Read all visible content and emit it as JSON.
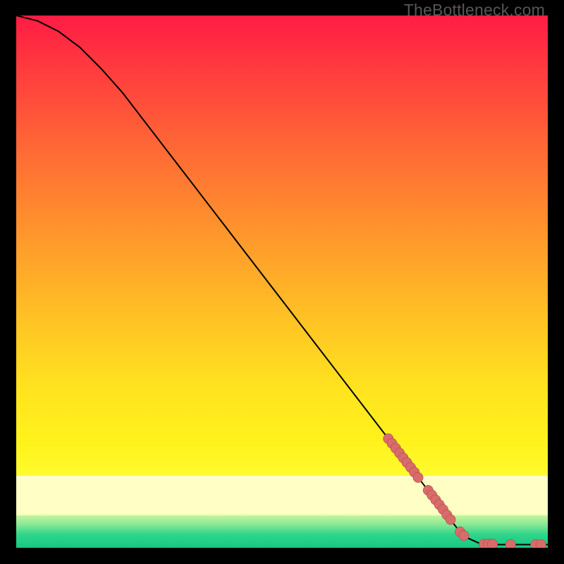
{
  "watermark": "TheBottleneck.com",
  "colors": {
    "frame_bg": "#000000",
    "curve": "#000000",
    "marker_fill": "#d96b6b",
    "marker_stroke": "#9e3f3f"
  },
  "chart_data": {
    "type": "line",
    "title": "",
    "xlabel": "",
    "ylabel": "",
    "xlim": [
      0,
      100
    ],
    "ylim": [
      0,
      100
    ],
    "curve": [
      {
        "x": 0,
        "y": 100
      },
      {
        "x": 4,
        "y": 99
      },
      {
        "x": 8,
        "y": 97
      },
      {
        "x": 12,
        "y": 94
      },
      {
        "x": 16,
        "y": 90
      },
      {
        "x": 20,
        "y": 85.5
      },
      {
        "x": 25,
        "y": 79
      },
      {
        "x": 30,
        "y": 72.5
      },
      {
        "x": 35,
        "y": 66
      },
      {
        "x": 40,
        "y": 59.5
      },
      {
        "x": 45,
        "y": 53
      },
      {
        "x": 50,
        "y": 46.5
      },
      {
        "x": 55,
        "y": 40
      },
      {
        "x": 60,
        "y": 33.5
      },
      {
        "x": 65,
        "y": 27
      },
      {
        "x": 70,
        "y": 20.5
      },
      {
        "x": 75,
        "y": 14
      },
      {
        "x": 80,
        "y": 7.5
      },
      {
        "x": 83,
        "y": 3.6
      },
      {
        "x": 85,
        "y": 1.8
      },
      {
        "x": 87,
        "y": 0.9
      },
      {
        "x": 90,
        "y": 0.6
      },
      {
        "x": 95,
        "y": 0.6
      },
      {
        "x": 100,
        "y": 0.6
      }
    ],
    "markers": [
      {
        "x": 70.0,
        "y": 20.5
      },
      {
        "x": 70.7,
        "y": 19.6
      },
      {
        "x": 71.4,
        "y": 18.7
      },
      {
        "x": 72.1,
        "y": 17.8
      },
      {
        "x": 72.8,
        "y": 16.9
      },
      {
        "x": 73.5,
        "y": 16.0
      },
      {
        "x": 74.2,
        "y": 15.1
      },
      {
        "x": 74.9,
        "y": 14.2
      },
      {
        "x": 75.6,
        "y": 13.2
      },
      {
        "x": 77.5,
        "y": 10.8
      },
      {
        "x": 78.2,
        "y": 9.9
      },
      {
        "x": 78.9,
        "y": 9.0
      },
      {
        "x": 79.6,
        "y": 8.1
      },
      {
        "x": 80.3,
        "y": 7.2
      },
      {
        "x": 81.0,
        "y": 6.2
      },
      {
        "x": 81.7,
        "y": 5.3
      },
      {
        "x": 83.5,
        "y": 3.0
      },
      {
        "x": 84.2,
        "y": 2.3
      },
      {
        "x": 88.0,
        "y": 0.7
      },
      {
        "x": 88.8,
        "y": 0.7
      },
      {
        "x": 89.6,
        "y": 0.7
      },
      {
        "x": 93.0,
        "y": 0.6
      },
      {
        "x": 97.7,
        "y": 0.6
      },
      {
        "x": 98.7,
        "y": 0.6
      }
    ]
  }
}
